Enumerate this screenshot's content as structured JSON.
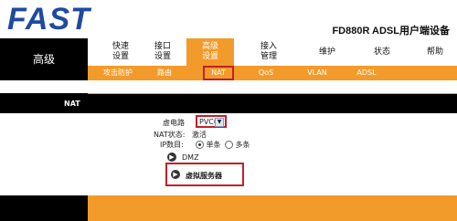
{
  "header": {
    "logo": "FAST",
    "model": "FD880R ADSL用户端设备"
  },
  "nav": {
    "left_title": "高级",
    "tabs": [
      {
        "line1": "快速",
        "line2": "设置"
      },
      {
        "line1": "接口",
        "line2": "设置"
      },
      {
        "line1": "高级",
        "line2": "设置"
      },
      {
        "line1": "接入",
        "line2": "管理"
      },
      {
        "label": "维护"
      },
      {
        "label": "状态"
      },
      {
        "label": "帮助"
      }
    ]
  },
  "subnav": {
    "items": [
      "攻击防护",
      "路由",
      "NAT",
      "QoS",
      "VLAN",
      "ADSL"
    ]
  },
  "section": {
    "title": "NAT"
  },
  "form": {
    "vc_label": "虚电路",
    "vc_value": "PVC0",
    "nat_status_label": "NAT状态:",
    "nat_status_value": "激活",
    "ip_count_label": "IP数目:",
    "ip_single": "单条",
    "ip_multi": "多条"
  },
  "links": {
    "dmz": "DMZ",
    "virtual_server": "虚拟服务器"
  },
  "colors": {
    "orange": "#f39b2a",
    "logo_blue": "#1f4aa0",
    "highlight_red": "#c0202a"
  }
}
